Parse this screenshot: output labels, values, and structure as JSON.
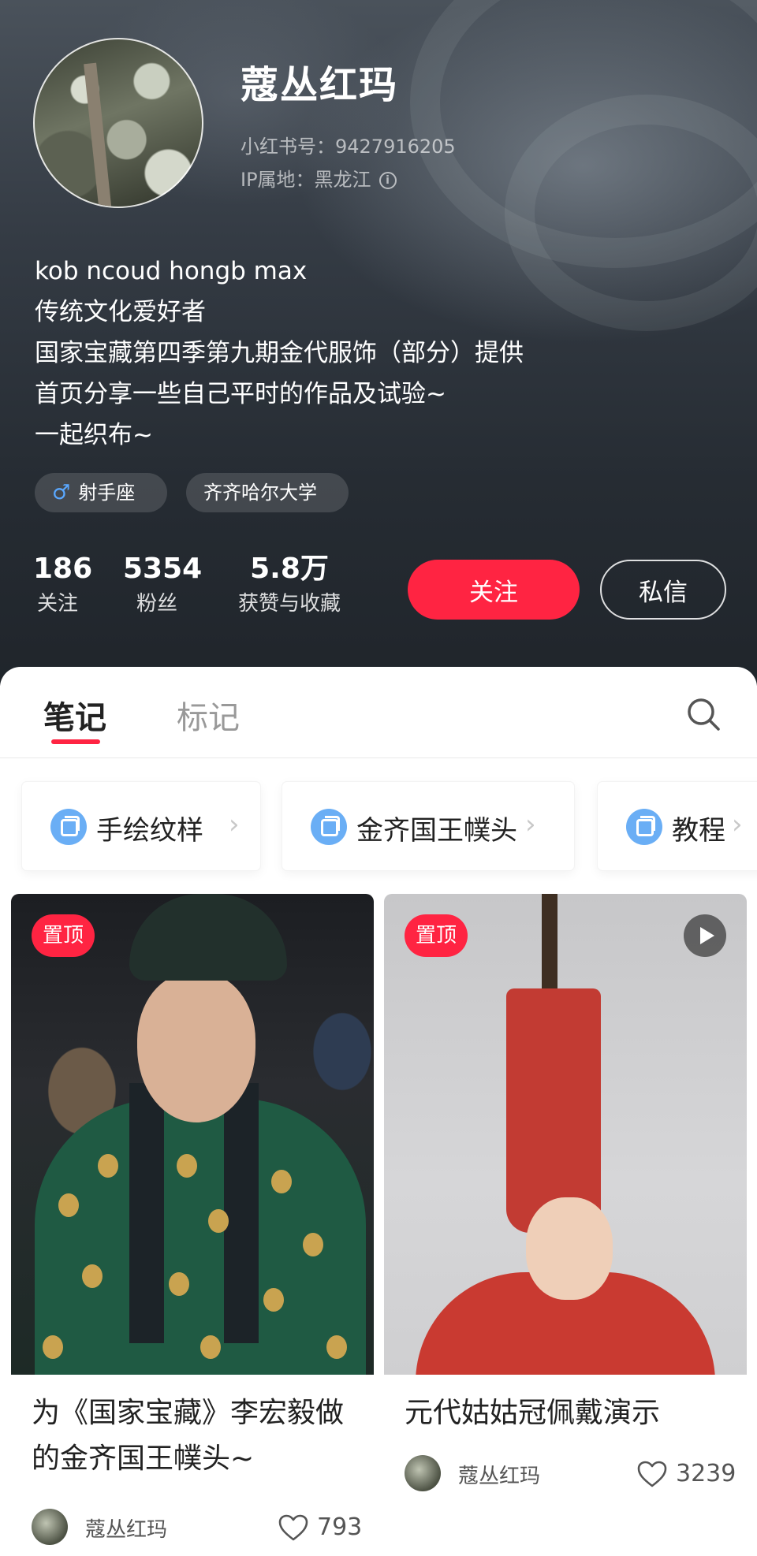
{
  "profile": {
    "nickname": "蔻丛红玛",
    "xhs_id": "小红书号：9427916205",
    "ip_location": "IP属地：黑龙江",
    "bio": [
      "kob ncoud hongb max",
      "传统文化爱好者",
      "国家宝藏第四季第九期金代服饰（部分）提供",
      "首页分享一些自己平时的作品及试验~",
      "一起织布~"
    ],
    "tags": {
      "zodiac": "射手座",
      "school": "齐齐哈尔大学"
    },
    "stats": {
      "following": {
        "value": "186",
        "label": "关注"
      },
      "followers": {
        "value": "5354",
        "label": "粉丝"
      },
      "likes_collects": {
        "value": "5.8万",
        "label": "获赞与收藏"
      }
    },
    "buttons": {
      "follow": "关注",
      "message": "私信"
    }
  },
  "tabs": {
    "notes": "笔记",
    "marks": "标记"
  },
  "albums": [
    {
      "label": "手绘纹样"
    },
    {
      "label": "金齐国王幞头"
    },
    {
      "label": "教程"
    }
  ],
  "cards": [
    {
      "badge": "置顶",
      "title": "为《国家宝藏》李宏毅做的金齐国王幞头~",
      "author": "蔻丛红玛",
      "likes": "793",
      "is_video": false
    },
    {
      "badge": "置顶",
      "title": "元代姑姑冠佩戴演示",
      "author": "蔻丛红玛",
      "likes": "3239",
      "is_video": true
    }
  ],
  "colors": {
    "accent": "#ff2442",
    "album_icon": "#6aaef5",
    "zodiac_icon": "#5aa8ff"
  },
  "icons": [
    "info-icon",
    "male-icon",
    "search-icon",
    "album-icon",
    "chevron-right-icon",
    "play-icon",
    "heart-icon"
  ]
}
